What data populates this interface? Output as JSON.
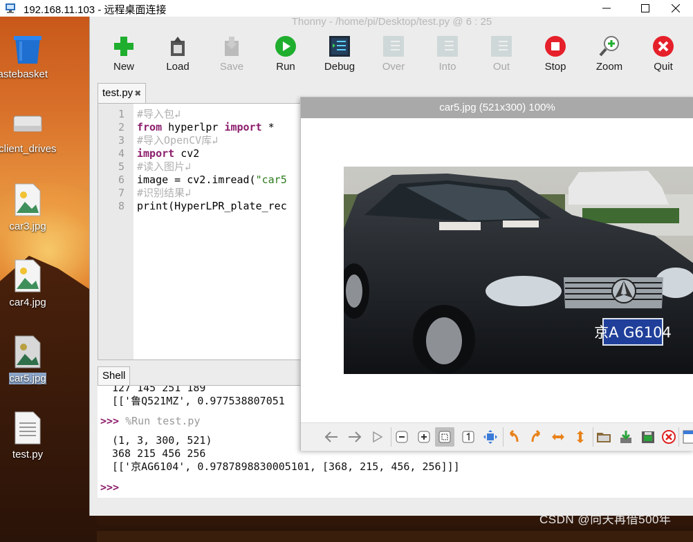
{
  "rdp": {
    "title": "192.168.11.103 - 远程桌面连接",
    "icon": "remote-desktop-icon"
  },
  "desktop": {
    "icons": [
      {
        "label": "Wastebasket",
        "icon": "trash-icon"
      },
      {
        "label": "thinclient_drives",
        "icon": "drive-icon"
      },
      {
        "label": "car3.jpg",
        "icon": "image-file-icon"
      },
      {
        "label": "car4.jpg",
        "icon": "image-file-icon"
      },
      {
        "label": "car5.jpg",
        "icon": "image-file-icon"
      },
      {
        "label": "test.py",
        "icon": "text-file-icon"
      }
    ]
  },
  "thonny": {
    "title": "Thonny  -  /home/pi/Desktop/test.py  @  6 : 25",
    "toolbar": {
      "new": "New",
      "load": "Load",
      "save": "Save",
      "run": "Run",
      "debug": "Debug",
      "over": "Over",
      "into": "Into",
      "out": "Out",
      "stop": "Stop",
      "zoom": "Zoom",
      "quit": "Quit"
    },
    "editor_tab": "test.py",
    "editor_tab_close": "✖",
    "line_numbers": [
      "1",
      "2",
      "3",
      "4",
      "5",
      "6",
      "7",
      "8"
    ],
    "code": {
      "l1": "#导入包↲",
      "l2_kw1": "from",
      "l2_mid": " hyperlpr ",
      "l2_kw2": "import",
      "l2_end": " *",
      "l3": "#导入OpenCV库↲",
      "l4_kw": "import",
      "l4_end": " cv2",
      "l5": "#读入图片↲",
      "l6_a": "image = cv2.imread(",
      "l6_str": "\"car5",
      "l7": "#识别结果↲",
      "l8": "print(HyperLPR_plate_rec"
    },
    "shell_tab": "Shell",
    "shell": {
      "l1": "127 145 251 189",
      "l2": "[['鲁Q521MZ', 0.977538807051",
      "prompt": ">>>",
      "run": "%Run test.py",
      "l4": "(1, 3, 300, 521)",
      "l5": "368 215 456 256",
      "l6": "[['京AG6104', 0.9787898830005101, [368, 215, 456, 256]]]",
      "prompt2": ">>>"
    }
  },
  "viewer": {
    "title": "car5.jpg (521x300) 100%",
    "plate_text": "京A G6104"
  },
  "watermark": "CSDN @向天再借500年",
  "colors": {
    "keyword": "#8b1d6b",
    "string": "#2b7a1c",
    "comment": "#b0b0b0"
  }
}
